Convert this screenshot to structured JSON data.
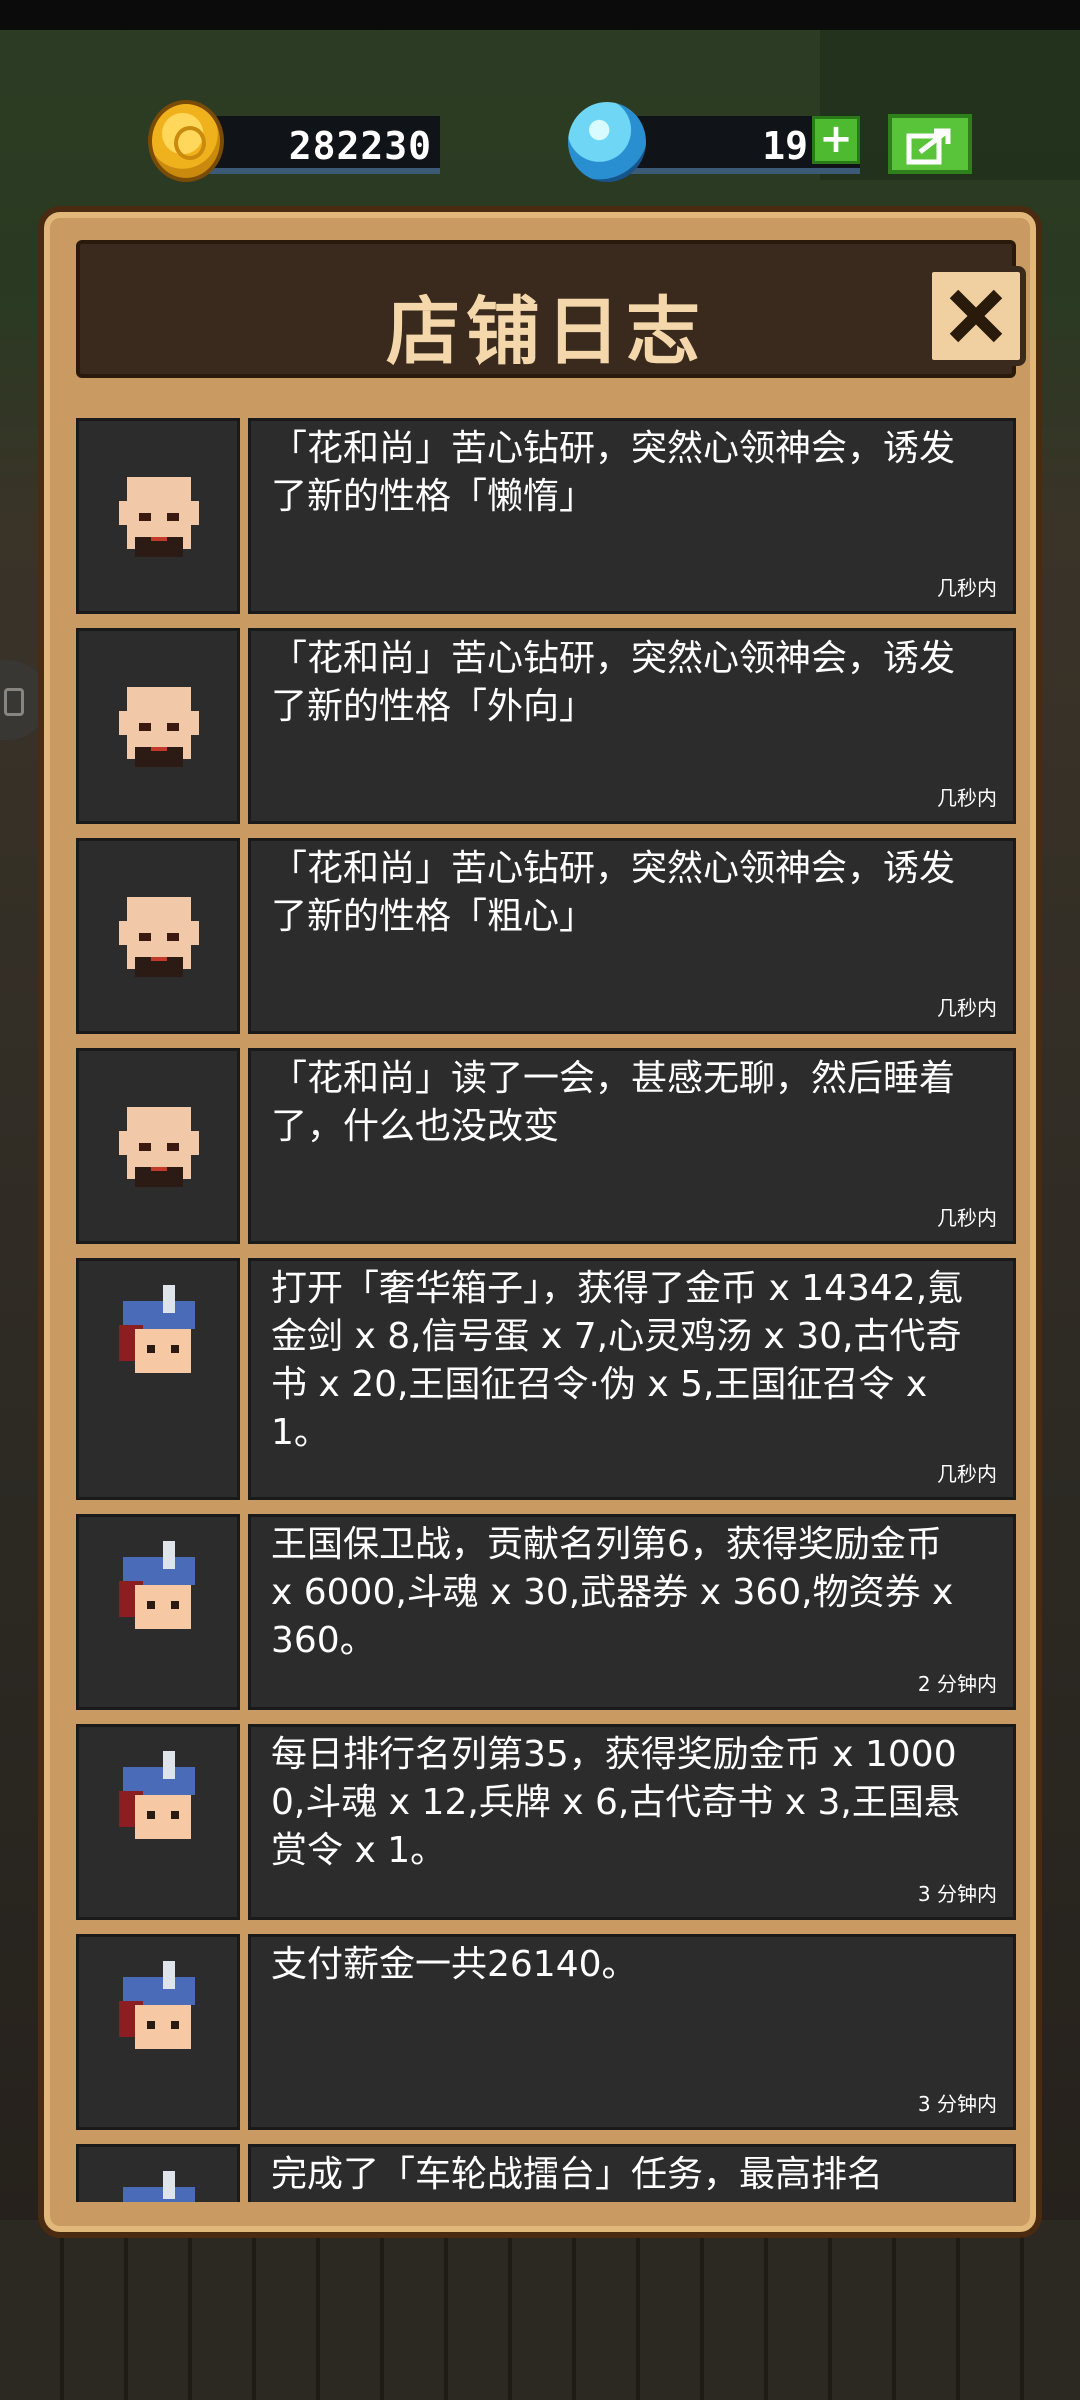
{
  "currency": {
    "gold": "282230",
    "gems": "19",
    "plus_label": "+"
  },
  "panel": {
    "title": "店铺日志"
  },
  "logs": [
    {
      "text": "「花和尚」苦心钻研，突然心领神会，诱发了新的性格「懒惰」",
      "time": "几秒内",
      "avatar": "monk-avatar"
    },
    {
      "text": "「花和尚」苦心钻研，突然心领神会，诱发了新的性格「外向」",
      "time": "几秒内",
      "avatar": "monk-avatar"
    },
    {
      "text": "「花和尚」苦心钻研，突然心领神会，诱发了新的性格「粗心」",
      "time": "几秒内",
      "avatar": "monk-avatar"
    },
    {
      "text": "「花和尚」读了一会，甚感无聊，然后睡着了，什么也没改变",
      "time": "几秒内",
      "avatar": "monk-avatar"
    },
    {
      "text": "打开「奢华箱子」，获得了金币 x 14342,氪金剑 x 8,信号蛋 x 7,心灵鸡汤 x 30,古代奇书 x 20,王国征召令·伪 x 5,王国征召令 x 1。",
      "time": "几秒内",
      "avatar": "shopkeeper-avatar"
    },
    {
      "text": "王国保卫战，贡献名列第6，获得奖励金币 x 6000,斗魂 x 30,武器券 x 360,物资券 x 360。",
      "time": "2 分钟内",
      "avatar": "shopkeeper-avatar"
    },
    {
      "text": "每日排行名列第35，获得奖励金币 x 10000,斗魂 x 12,兵牌 x 6,古代奇书 x 3,王国悬赏令 x 1。",
      "time": "3 分钟内",
      "avatar": "shopkeeper-avatar"
    },
    {
      "text": "支付薪金一共26140。",
      "time": "3 分钟内",
      "avatar": "shopkeeper-avatar"
    },
    {
      "text": "完成了「车轮战擂台」任务，最高排名",
      "time": "",
      "avatar": "shopkeeper-avatar"
    }
  ],
  "colors": {
    "panel_frame": "#c99b62",
    "row_bg": "#2c2c2c",
    "title": "#f4d8ac",
    "plus_green": "#4dba2f"
  }
}
